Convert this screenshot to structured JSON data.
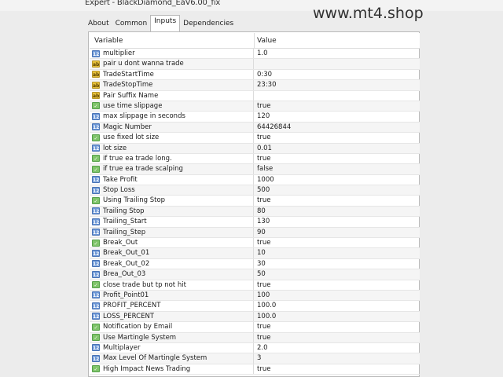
{
  "window": {
    "title": "Expert - BlackDiamond_EaV6.00_fix"
  },
  "watermark": "www.mt4.shop",
  "tabs": [
    {
      "label": "About",
      "active": false
    },
    {
      "label": "Common",
      "active": false
    },
    {
      "label": "Inputs",
      "active": true
    },
    {
      "label": "Dependencies",
      "active": false
    }
  ],
  "table": {
    "columns": [
      "Variable",
      "Value"
    ],
    "rows": [
      {
        "icon": "number-icon",
        "name": "multiplier",
        "value": "1.0"
      },
      {
        "icon": "string-icon",
        "name": "pair u dont wanna trade",
        "value": ""
      },
      {
        "icon": "string-icon",
        "name": "TradeStartTime",
        "value": "0:30"
      },
      {
        "icon": "string-icon",
        "name": "TradeStopTime",
        "value": "23:30"
      },
      {
        "icon": "string-icon",
        "name": "Pair Suffix Name",
        "value": ""
      },
      {
        "icon": "bool-icon",
        "name": "use time slippage",
        "value": "true"
      },
      {
        "icon": "number-icon",
        "name": "max slippage in seconds",
        "value": "120"
      },
      {
        "icon": "number-icon",
        "name": "Magic Number",
        "value": "64426844"
      },
      {
        "icon": "bool-icon",
        "name": "use fixed lot size",
        "value": "true"
      },
      {
        "icon": "number-icon",
        "name": "lot size",
        "value": "0.01"
      },
      {
        "icon": "bool-icon",
        "name": "if true ea trade long.",
        "value": "true"
      },
      {
        "icon": "bool-icon",
        "name": "if true ea trade scalping",
        "value": "false"
      },
      {
        "icon": "number-icon",
        "name": "Take Profit",
        "value": "1000"
      },
      {
        "icon": "number-icon",
        "name": "Stop Loss",
        "value": "500"
      },
      {
        "icon": "bool-icon",
        "name": "Using Trailing Stop",
        "value": "true"
      },
      {
        "icon": "number-icon",
        "name": "Trailing Stop",
        "value": "80"
      },
      {
        "icon": "number-icon",
        "name": "Trailing_Start",
        "value": "130"
      },
      {
        "icon": "number-icon",
        "name": "Trailing_Step",
        "value": "90"
      },
      {
        "icon": "bool-icon",
        "name": "Break_Out",
        "value": "true"
      },
      {
        "icon": "number-icon",
        "name": "Break_Out_01",
        "value": "10"
      },
      {
        "icon": "number-icon",
        "name": "Break_Out_02",
        "value": "30"
      },
      {
        "icon": "number-icon",
        "name": "Brea_Out_03",
        "value": "50"
      },
      {
        "icon": "bool-icon",
        "name": "close trade but tp not hit",
        "value": "true"
      },
      {
        "icon": "number-icon",
        "name": "Profit_Point01",
        "value": "100"
      },
      {
        "icon": "number-icon",
        "name": "PROFIT_PERCENT",
        "value": "100.0"
      },
      {
        "icon": "number-icon",
        "name": "LOSS_PERCENT",
        "value": "100.0"
      },
      {
        "icon": "bool-icon",
        "name": "Notification by Email",
        "value": "true"
      },
      {
        "icon": "bool-icon",
        "name": "Use Martingle System",
        "value": "true"
      },
      {
        "icon": "number-icon",
        "name": "Multiplayer",
        "value": "2.0"
      },
      {
        "icon": "number-icon",
        "name": "Max Level Of Martingle System",
        "value": "3"
      },
      {
        "icon": "bool-icon",
        "name": "High Impact News Trading",
        "value": "true"
      }
    ]
  },
  "colors": {
    "number_icon": "#6c97d6",
    "string_icon": "#e6c13a",
    "bool_icon": "#7fc46a"
  }
}
